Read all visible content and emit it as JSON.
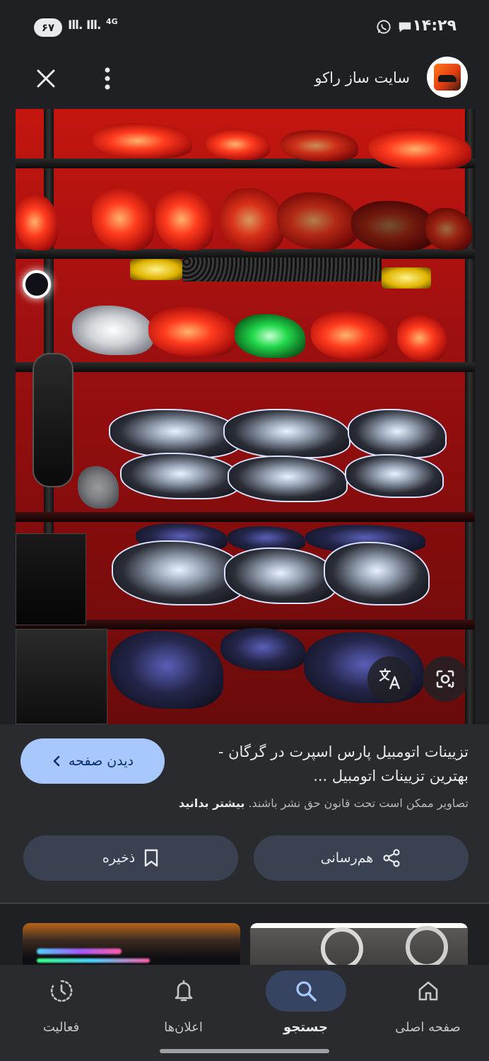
{
  "status_bar": {
    "time": "۱۴:۲۹",
    "battery": "۶۷",
    "signal_1": "Ill.",
    "signal_2": "Ill.",
    "network": "4G",
    "icons": [
      "whatsapp-icon",
      "chat-icon"
    ]
  },
  "app_bar": {
    "site_name": "سایت ساز راکو",
    "close_icon": "close-icon",
    "more_icon": "more-vert-icon"
  },
  "photo": {
    "actions": [
      "translate-icon",
      "lens-icon"
    ]
  },
  "result": {
    "title": "تزیینات اتومبیل پارس اسپرت در گرگان - بهترین تزیینات اتومبیل ...",
    "visit_button": "دیدن صفحه",
    "copyright_text": "تصاویر ممکن است تحت قانون حق نشر باشند.",
    "learn_more": "بیشتر بدانید",
    "share_button": "هم‌رسانی",
    "save_button": "ذخیره"
  },
  "bottom_nav": {
    "items": [
      {
        "label": "صفحه اصلی",
        "icon": "home-icon",
        "active": false
      },
      {
        "label": "جستجو",
        "icon": "search-icon",
        "active": true
      },
      {
        "label": "اعلان‌ها",
        "icon": "bell-icon",
        "active": false
      },
      {
        "label": "فعالیت",
        "icon": "activity-icon",
        "active": false
      }
    ]
  },
  "colors": {
    "background": "#1f2023",
    "panel": "#2a2b2f",
    "primary_button": "#a8c7fa",
    "secondary_button": "#3a4252",
    "active_nav": "#374461"
  }
}
